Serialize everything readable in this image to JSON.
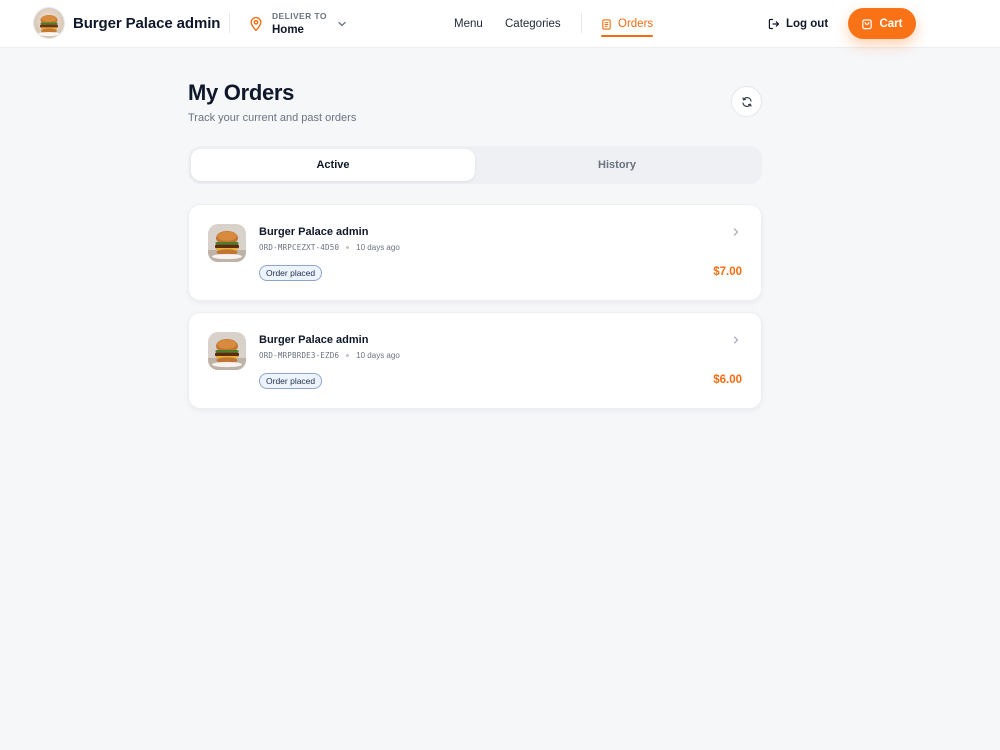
{
  "header": {
    "brand_name": "Burger Palace admin",
    "deliver_label": "DELIVER TO",
    "deliver_value": "Home",
    "nav": {
      "menu": "Menu",
      "categories": "Categories",
      "orders": "Orders"
    },
    "logout_label": "Log out",
    "cart_label": "Cart"
  },
  "page": {
    "title": "My Orders",
    "subtitle": "Track your current and past orders"
  },
  "tabs": {
    "active": "Active",
    "history": "History"
  },
  "orders": [
    {
      "restaurant": "Burger Palace admin",
      "id": "ORD-MRPCEZXT-4D50",
      "time": "10 days ago",
      "status": "Order placed",
      "price": "$7.00"
    },
    {
      "restaurant": "Burger Palace admin",
      "id": "ORD-MRPBRDE3-EZD6",
      "time": "10 days ago",
      "status": "Order placed",
      "price": "$6.00"
    }
  ],
  "colors": {
    "accent": "#f97316",
    "accent_text": "#f26d12",
    "background": "#f6f7f9"
  }
}
